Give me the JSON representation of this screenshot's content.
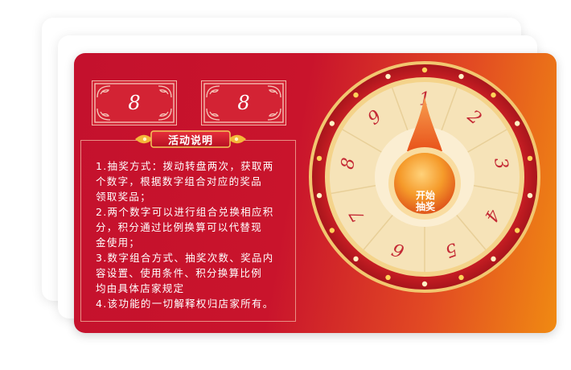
{
  "digits": [
    {
      "value": "8"
    },
    {
      "value": "8"
    }
  ],
  "rules": {
    "title": "活动说明",
    "items": [
      {
        "lines": [
          "1.抽奖方式：拨动转盘两次，获取两",
          "个数字，根据数字组合对应的奖品",
          "领取奖品；"
        ]
      },
      {
        "lines": [
          "2.两个数字可以进行组合兑换相应积",
          "分，积分通过比例换算可以代替现",
          "金使用；"
        ]
      },
      {
        "lines": [
          "3.数字组合方式、抽奖次数、奖品内",
          "容设置、使用条件、积分换算比例",
          "均由具体店家规定"
        ]
      },
      {
        "lines": [
          "4.该功能的一切解释权归店家所有。"
        ]
      }
    ]
  },
  "wheel": {
    "segments": [
      "1",
      "2",
      "3",
      "4",
      "5",
      "6",
      "7",
      "8",
      "9"
    ],
    "start_button": {
      "line1": "开始",
      "line2": "抽奖"
    }
  },
  "colors": {
    "card_red": "#c4112d",
    "card_orange": "#f08a12",
    "wheel_rim": "#c51f24",
    "wheel_face": "#f6e3b8",
    "digit_red": "#c42a35",
    "pointer_orange": "#f06a1c"
  }
}
